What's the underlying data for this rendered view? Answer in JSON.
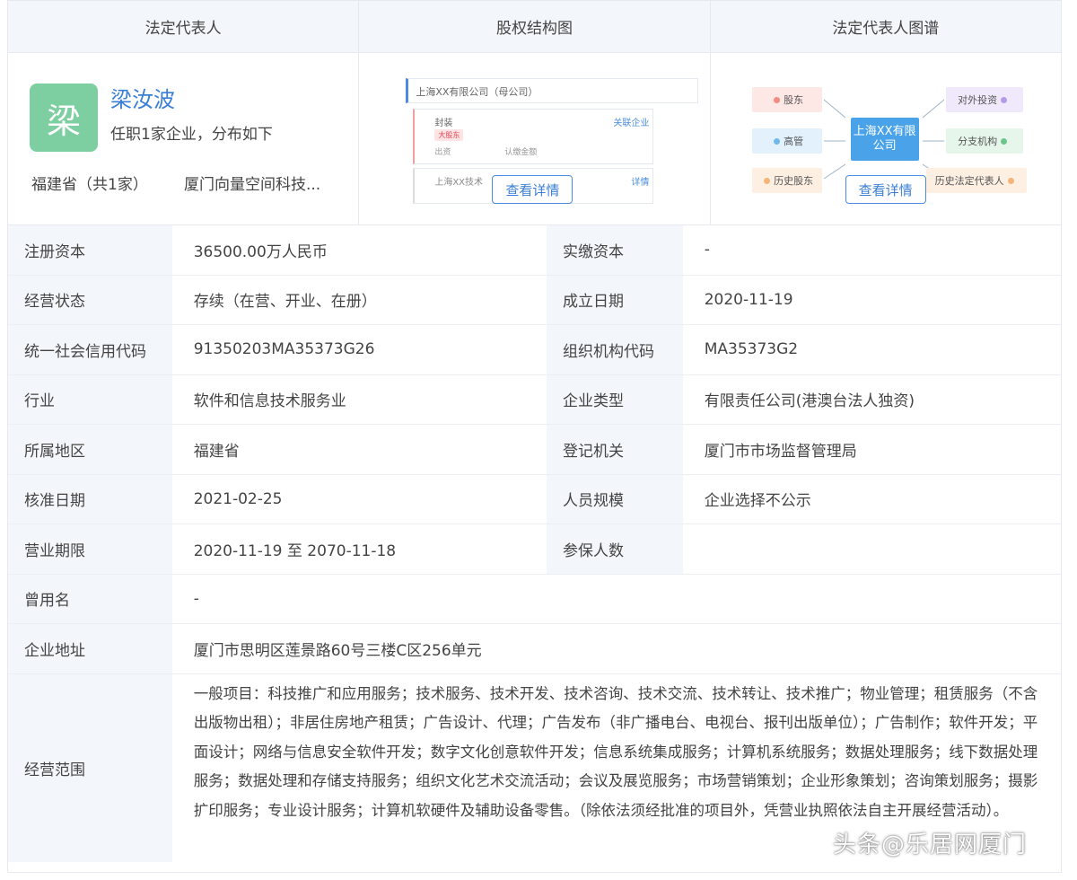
{
  "header_tabs": [
    "法定代表人",
    "股权结构图",
    "法定代表人图谱"
  ],
  "legal_rep": {
    "avatar_char": "梁",
    "name": "梁汝波",
    "summary": "任职1家企业，分布如下",
    "province": "福建省（共1家）",
    "company": "厦门向量空间科技..."
  },
  "equity_thumb": {
    "title": "上海XX有限公司（母公司）",
    "row1_name": "封装",
    "row1_tag": "大股东",
    "row1_link": "关联企业",
    "row1_meta_a": "出资",
    "row1_meta_b": "认缴金额",
    "row2_name": "上海XX技术",
    "row2_link": "详情",
    "button": "查看详情"
  },
  "graph_thumb": {
    "nodes_left": [
      "股东",
      "高管",
      "历史股东"
    ],
    "center": "上海XX有限公司",
    "nodes_right": [
      "对外投资",
      "分支机构",
      "历史法定代表人"
    ],
    "button": "查看详情"
  },
  "info_rows": [
    {
      "l1": "注册资本",
      "v1": "36500.00万人民币",
      "l2": "实缴资本",
      "v2": "-"
    },
    {
      "l1": "经营状态",
      "v1": "存续（在营、开业、在册）",
      "l2": "成立日期",
      "v2": "2020-11-19"
    },
    {
      "l1": "统一社会信用代码",
      "v1": "91350203MA35373G26",
      "l2": "组织机构代码",
      "v2": "MA35373G2"
    },
    {
      "l1": "行业",
      "v1": "软件和信息技术服务业",
      "l2": "企业类型",
      "v2": "有限责任公司(港澳台法人独资)"
    },
    {
      "l1": "所属地区",
      "v1": "福建省",
      "l2": "登记机关",
      "v2": "厦门市市场监督管理局"
    },
    {
      "l1": "核准日期",
      "v1": "2021-02-25",
      "l2": "人员规模",
      "v2": "企业选择不公示"
    },
    {
      "l1": "营业期限",
      "v1": "2020-11-19 至 2070-11-18",
      "l2": "参保人数",
      "v2": ""
    }
  ],
  "former_name": {
    "label": "曾用名",
    "value": "-"
  },
  "address": {
    "label": "企业地址",
    "value": "厦门市思明区莲景路60号三楼C区256单元"
  },
  "scope": {
    "label": "经营范围",
    "value": "一般项目：科技推广和应用服务；技术服务、技术开发、技术咨询、技术交流、技术转让、技术推广；物业管理；租赁服务（不含出版物出租）；非居住房地产租赁；广告设计、代理；广告发布（非广播电台、电视台、报刊出版单位）；广告制作；软件开发；平面设计；网络与信息安全软件开发；数字文化创意软件开发；信息系统集成服务；计算机系统服务；数据处理服务；线下数据处理服务；数据处理和存储支持服务；组织文化艺术交流活动；会议及展览服务；市场营销策划；企业形象策划；咨询策划服务；摄影扩印服务；专业设计服务；计算机软硬件及辅助设备零售。（除依法须经批准的项目外，凭营业执照依法自主开展经营活动）。"
  },
  "watermark": "头条@乐居网厦门"
}
